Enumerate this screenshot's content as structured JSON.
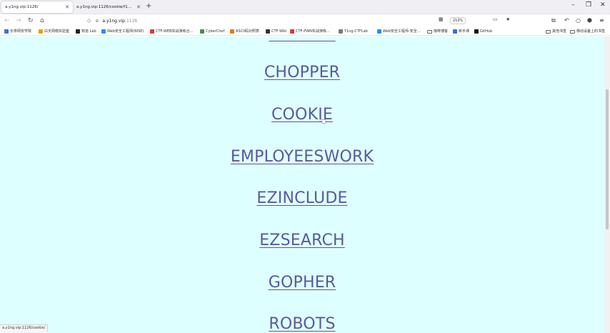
{
  "tabs": [
    {
      "label": "a.y1ng.vip:1126/",
      "active": true
    },
    {
      "label": "a.y1ng.vip:1126/cookie/f14g.txt",
      "active": false
    }
  ],
  "navbar": {
    "url_host": "a.y1ng.vip",
    "url_path": ":1126",
    "zoom_level": "210%"
  },
  "bookmarks": [
    {
      "label": "长亭网安学院",
      "color": "#3b6fd6"
    },
    {
      "label": "白天网络实验室",
      "color": "#e0a21a"
    },
    {
      "label": "知道 Lab",
      "color": "#222222"
    },
    {
      "label": "Web安全工程师(NISE)",
      "color": "#2f8be6"
    },
    {
      "label": "CTF-WEB实战演练合…",
      "color": "#d43b3b"
    },
    {
      "label": "CyberChef",
      "color": "#4b8f4b"
    },
    {
      "label": "ASCII码对照表",
      "color": "#e07b1f"
    },
    {
      "label": "CTF Wiki",
      "color": "#333333"
    },
    {
      "label": "CTF-PWN实战演练…",
      "color": "#d43b3b"
    },
    {
      "label": "Y1ng-CTFLab",
      "color": "#7a7a7a"
    },
    {
      "label": "Web安全工程师-安全…",
      "color": "#2f8be6"
    },
    {
      "label": "咖啡博客",
      "folder": true
    },
    {
      "label": "新手课",
      "color": "#3b6fd6"
    },
    {
      "label": "GitHub",
      "color": "#111111"
    }
  ],
  "bookmarks_right": [
    {
      "label": "其他书签",
      "folder": true
    },
    {
      "label": "移动设备上的书签",
      "folder": true
    }
  ],
  "links": [
    "CHOPPER",
    "COOKIE",
    "EMPLOYEESWORK",
    "EZINCLUDE",
    "EZSEARCH",
    "GOPHER",
    "ROBOTS"
  ],
  "status_text": "a.y1ng.vip:1126/cookie/"
}
